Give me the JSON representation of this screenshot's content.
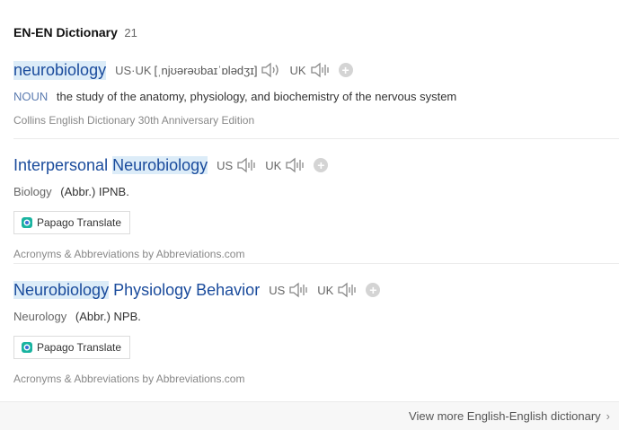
{
  "header": {
    "title": "EN-EN Dictionary",
    "count": "21"
  },
  "entries": [
    {
      "headword": "neurobiology",
      "pron": {
        "us_uk_label": "US·UK",
        "ipa": "[ˌnjʊərəʊbaɪˈɒlədʒɪ]",
        "uk_label": "UK"
      },
      "pos": "NOUN",
      "definition": "the study of the anatomy, physiology, and biochemistry of the nervous system",
      "source": "Collins English Dictionary 30th Anniversary Edition"
    },
    {
      "headword_a": "Interpersonal",
      "headword_b": "Neurobiology",
      "us_label": "US",
      "uk_label": "UK",
      "field": "Biology",
      "definition": "(Abbr.) IPNB.",
      "translate_label": "Papago Translate",
      "source": "Acronyms & Abbreviations by Abbreviations.com"
    },
    {
      "headword_a": "Neurobiology",
      "headword_b": "Physiology Behavior",
      "us_label": "US",
      "uk_label": "UK",
      "field": "Neurology",
      "definition": "(Abbr.) NPB.",
      "translate_label": "Papago Translate",
      "source": "Acronyms & Abbreviations by Abbreviations.com"
    }
  ],
  "add_symbol": "+",
  "footer": {
    "more_label": "View more English-English dictionary",
    "chevron": "›"
  },
  "icons": {
    "speaker": "speaker-icon",
    "add": "add-icon",
    "papago": "papago-logo-icon",
    "chevron": "chevron-right-icon"
  },
  "colors": {
    "headword": "#1a4b9c",
    "highlight": "#dcecf8",
    "pos": "#5b7bb0"
  }
}
